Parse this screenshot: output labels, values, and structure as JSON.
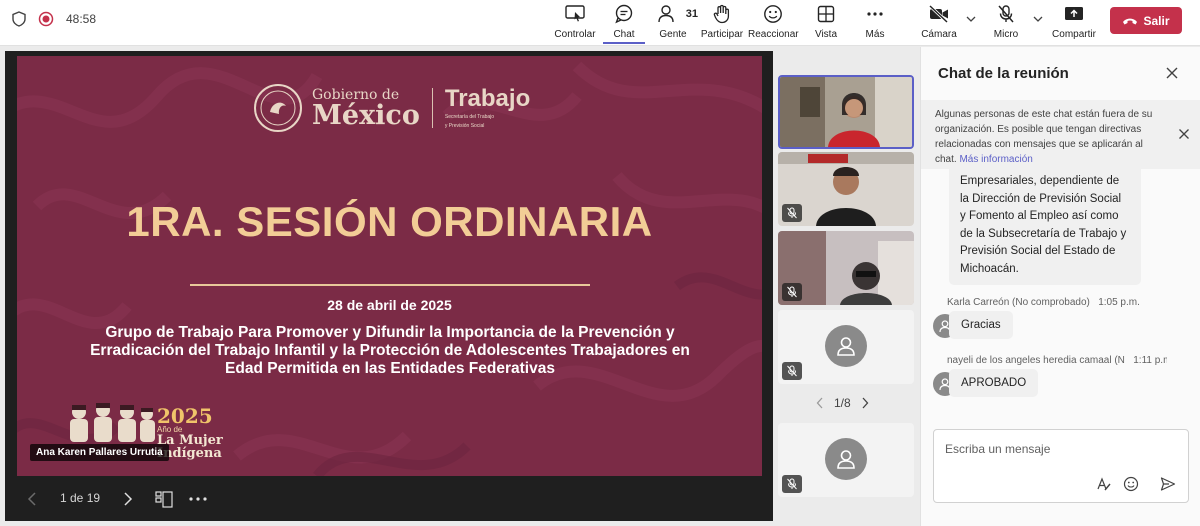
{
  "topbar": {
    "timer": "48:58",
    "tools": [
      {
        "label": "Controlar",
        "icon": "share-screen-control-icon"
      },
      {
        "label": "Chat",
        "icon": "chat-icon"
      },
      {
        "label": "Gente",
        "icon": "people-icon",
        "count": "31"
      },
      {
        "label": "Participar",
        "icon": "raise-hand-icon"
      },
      {
        "label": "Reaccionar",
        "icon": "smiley-icon"
      },
      {
        "label": "Vista",
        "icon": "grid-view-icon"
      },
      {
        "label": "Más",
        "icon": "more-icon"
      },
      {
        "label": "Cámara",
        "icon": "camera-off-icon"
      },
      {
        "label": "Micro",
        "icon": "mic-off-icon"
      },
      {
        "label": "Compartir",
        "icon": "share-icon"
      }
    ],
    "leave_label": "Salir",
    "accent": "#5b5fc7",
    "leave_color": "#c4314b"
  },
  "slide": {
    "logo_line1": "Gobierno de",
    "logo_line2": "México",
    "logo_right": "Trabajo",
    "logo_right_sub1": "Secretaría del Trabajo",
    "logo_right_sub2": "y Previsión Social",
    "title": "1RA. SESIÓN ORDINARIA",
    "date": "28 de abril de 2025",
    "description": "Grupo de Trabajo Para Promover y Difundir la Importancia de la Prevención y Erradicación del Trabajo Infantil y la Protección de Adolescentes Trabajadores en Edad Permitida en las Entidades Federativas",
    "year": "2025",
    "year_sub": "Año de",
    "year_tag1": "La Mujer",
    "year_tag2": "Indígena",
    "background": "#7b2b46",
    "title_color": "#f2cd96"
  },
  "presenter_name": "Ana Karen Pallares Urrutia",
  "stage_controls": {
    "page": "1 de 19"
  },
  "gallery": {
    "pager": "1/8"
  },
  "chat": {
    "title": "Chat de la reunión",
    "banner_text": "Algunas personas de este chat están fuera de su organización. Es posible que tengan directivas relacionadas con mensajes que se aplicarán al chat.",
    "banner_link": "Más información",
    "long_message": "Empresariales, dependiente de la Dirección de Previsión Social y Fomento al Empleo así como de la Subsecretaría de Trabajo y Previsión Social del Estado de Michoacán.",
    "messages": [
      {
        "author": "Karla Carreón (No comprobado)",
        "time": "1:05 p.m.",
        "text": "Gracias"
      },
      {
        "author": "nayeli de los angeles heredia camaal (N",
        "time": "1:11 p.m.",
        "text": "APROBADO"
      }
    ],
    "compose_placeholder": "Escriba un mensaje"
  }
}
